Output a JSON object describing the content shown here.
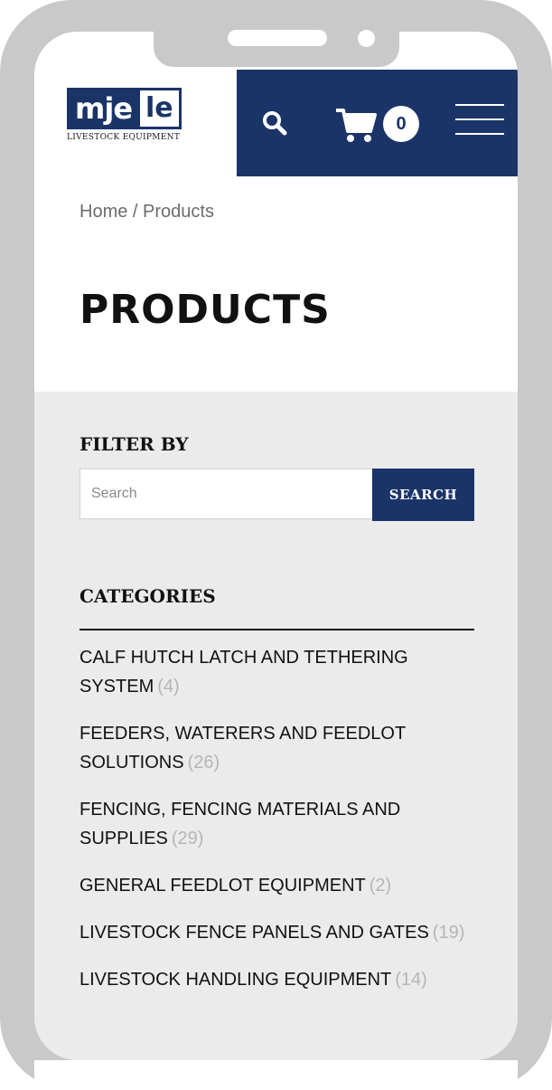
{
  "header": {
    "logo_mje": "mje",
    "logo_le": "le",
    "logo_tagline": "LIVESTOCK EQUIPMENT",
    "cart_count": "0",
    "icons": {
      "search": "search-icon",
      "cart": "cart-icon",
      "menu": "hamburger-menu-icon"
    }
  },
  "breadcrumb": "Home / Products",
  "page_title": "PRODUCTS",
  "filter": {
    "heading": "FILTER BY",
    "search_placeholder": "Search",
    "search_button": "SEARCH"
  },
  "categories": {
    "heading": "CATEGORIES",
    "items": [
      {
        "label": "CALF HUTCH LATCH AND TETHERING SYSTEM",
        "count": "(4)"
      },
      {
        "label": "FEEDERS, WATERERS AND FEEDLOT SOLUTIONS",
        "count": "(26)"
      },
      {
        "label": "FENCING, FENCING MATERIALS AND SUPPLIES",
        "count": "(29)"
      },
      {
        "label": "GENERAL FEEDLOT EQUIPMENT",
        "count": "(2)"
      },
      {
        "label": "LIVESTOCK FENCE PANELS AND GATES",
        "count": "(19)"
      },
      {
        "label": "LIVESTOCK HANDLING EQUIPMENT",
        "count": "(14)"
      }
    ]
  },
  "colors": {
    "brand_navy": "#1b3468",
    "sidebar_bg": "#ebebeb",
    "frame_gray": "#c9c9c9",
    "count_gray": "#b5b5b5"
  }
}
